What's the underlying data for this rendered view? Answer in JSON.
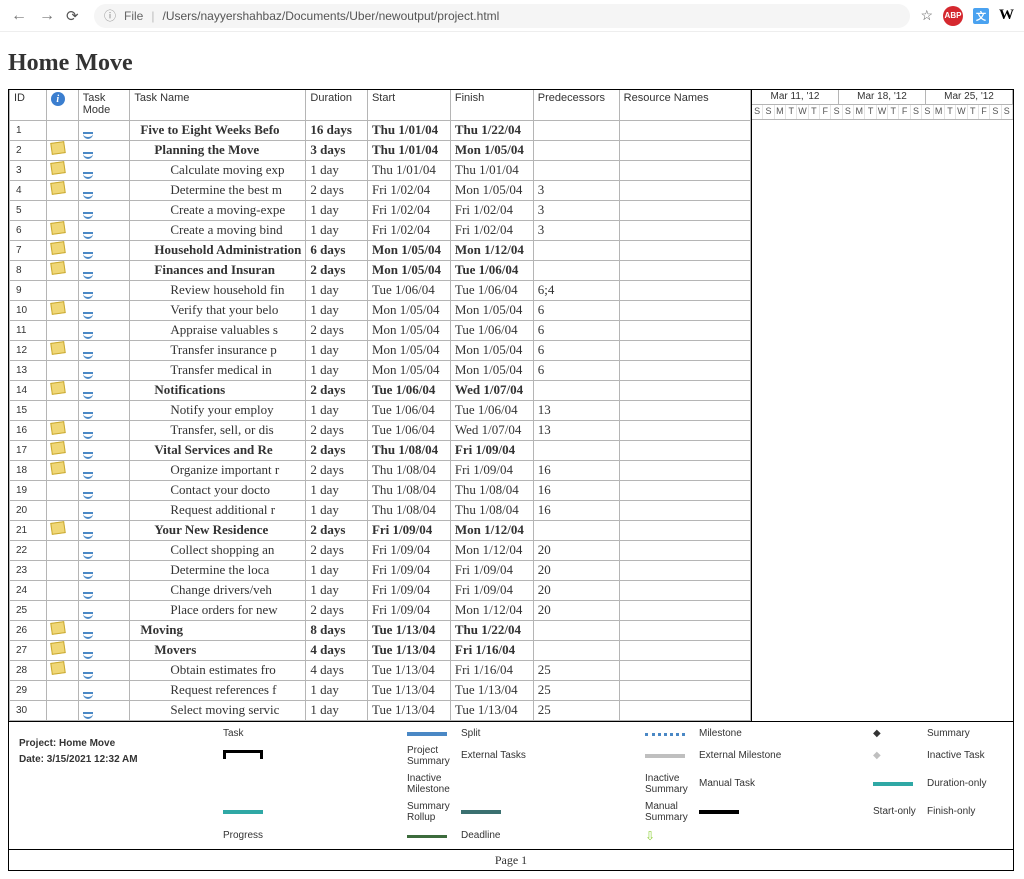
{
  "browser": {
    "omnibox_prefix": "File",
    "url": "/Users/nayyershahbaz/Documents/Uber/newoutput/project.html",
    "ext_abp": "ABP",
    "ext_w": "W"
  },
  "title": "Home Move",
  "headers": {
    "id": "ID",
    "info": "",
    "task_mode": "Task Mode",
    "task_name": "Task Name",
    "duration": "Duration",
    "start": "Start",
    "finish": "Finish",
    "predecessors": "Predecessors",
    "resource_names": "Resource Names"
  },
  "timeline_months": [
    "Mar 11, '12",
    "Mar 18, '12",
    "Mar 25, '12"
  ],
  "timeline_days": [
    "S",
    "S",
    "M",
    "T",
    "W",
    "T",
    "F",
    "S",
    "S",
    "M",
    "T",
    "W",
    "T",
    "F",
    "S",
    "S",
    "M",
    "T",
    "W",
    "T",
    "F",
    "S",
    "S"
  ],
  "rows": [
    {
      "id": "1",
      "note": false,
      "bold": true,
      "indent": 1,
      "name": "Five to Eight Weeks Befo",
      "dur": "16 days",
      "start": "Thu 1/01/04",
      "finish": "Thu 1/22/04",
      "pred": ""
    },
    {
      "id": "2",
      "note": true,
      "bold": true,
      "indent": 2,
      "name": "Planning the Move",
      "dur": "3 days",
      "start": "Thu 1/01/04",
      "finish": "Mon 1/05/04",
      "pred": ""
    },
    {
      "id": "3",
      "note": true,
      "bold": false,
      "indent": 3,
      "name": "Calculate moving exp",
      "dur": "1 day",
      "start": "Thu 1/01/04",
      "finish": "Thu 1/01/04",
      "pred": ""
    },
    {
      "id": "4",
      "note": true,
      "bold": false,
      "indent": 3,
      "name": "Determine the best m",
      "dur": "2 days",
      "start": "Fri 1/02/04",
      "finish": "Mon 1/05/04",
      "pred": "3"
    },
    {
      "id": "5",
      "note": false,
      "bold": false,
      "indent": 3,
      "name": "Create a moving-expe",
      "dur": "1 day",
      "start": "Fri 1/02/04",
      "finish": "Fri 1/02/04",
      "pred": "3"
    },
    {
      "id": "6",
      "note": true,
      "bold": false,
      "indent": 3,
      "name": "Create a moving bind",
      "dur": "1 day",
      "start": "Fri 1/02/04",
      "finish": "Fri 1/02/04",
      "pred": "3"
    },
    {
      "id": "7",
      "note": true,
      "bold": true,
      "indent": 2,
      "name": "Household Administration",
      "dur": "6 days",
      "start": "Mon 1/05/04",
      "finish": "Mon 1/12/04",
      "pred": ""
    },
    {
      "id": "8",
      "note": true,
      "bold": true,
      "indent": 2,
      "name": "Finances and Insuran",
      "dur": "2 days",
      "start": "Mon 1/05/04",
      "finish": "Tue 1/06/04",
      "pred": ""
    },
    {
      "id": "9",
      "note": false,
      "bold": false,
      "indent": 3,
      "name": "Review household fin",
      "dur": "1 day",
      "start": "Tue 1/06/04",
      "finish": "Tue 1/06/04",
      "pred": "6;4"
    },
    {
      "id": "10",
      "note": true,
      "bold": false,
      "indent": 3,
      "name": "Verify that your belo",
      "dur": "1 day",
      "start": "Mon 1/05/04",
      "finish": "Mon 1/05/04",
      "pred": "6"
    },
    {
      "id": "11",
      "note": false,
      "bold": false,
      "indent": 3,
      "name": "Appraise valuables s",
      "dur": "2 days",
      "start": "Mon 1/05/04",
      "finish": "Tue 1/06/04",
      "pred": "6"
    },
    {
      "id": "12",
      "note": true,
      "bold": false,
      "indent": 3,
      "name": "Transfer insurance p",
      "dur": "1 day",
      "start": "Mon 1/05/04",
      "finish": "Mon 1/05/04",
      "pred": "6"
    },
    {
      "id": "13",
      "note": false,
      "bold": false,
      "indent": 3,
      "name": "Transfer medical in",
      "dur": "1 day",
      "start": "Mon 1/05/04",
      "finish": "Mon 1/05/04",
      "pred": "6"
    },
    {
      "id": "14",
      "note": true,
      "bold": true,
      "indent": 2,
      "name": "Notifications",
      "dur": "2 days",
      "start": "Tue 1/06/04",
      "finish": "Wed 1/07/04",
      "pred": ""
    },
    {
      "id": "15",
      "note": false,
      "bold": false,
      "indent": 3,
      "name": "Notify your employ",
      "dur": "1 day",
      "start": "Tue 1/06/04",
      "finish": "Tue 1/06/04",
      "pred": "13"
    },
    {
      "id": "16",
      "note": true,
      "bold": false,
      "indent": 3,
      "name": "Transfer, sell, or dis",
      "dur": "2 days",
      "start": "Tue 1/06/04",
      "finish": "Wed 1/07/04",
      "pred": "13"
    },
    {
      "id": "17",
      "note": true,
      "bold": true,
      "indent": 2,
      "name": "Vital Services and Re",
      "dur": "2 days",
      "start": "Thu 1/08/04",
      "finish": "Fri 1/09/04",
      "pred": ""
    },
    {
      "id": "18",
      "note": true,
      "bold": false,
      "indent": 3,
      "name": "Organize important r",
      "dur": "2 days",
      "start": "Thu 1/08/04",
      "finish": "Fri 1/09/04",
      "pred": "16"
    },
    {
      "id": "19",
      "note": false,
      "bold": false,
      "indent": 3,
      "name": "Contact your docto",
      "dur": "1 day",
      "start": "Thu 1/08/04",
      "finish": "Thu 1/08/04",
      "pred": "16"
    },
    {
      "id": "20",
      "note": false,
      "bold": false,
      "indent": 3,
      "name": "Request additional r",
      "dur": "1 day",
      "start": "Thu 1/08/04",
      "finish": "Thu 1/08/04",
      "pred": "16"
    },
    {
      "id": "21",
      "note": true,
      "bold": true,
      "indent": 2,
      "name": "Your New Residence",
      "dur": "2 days",
      "start": "Fri 1/09/04",
      "finish": "Mon 1/12/04",
      "pred": ""
    },
    {
      "id": "22",
      "note": false,
      "bold": false,
      "indent": 3,
      "name": "Collect shopping an",
      "dur": "2 days",
      "start": "Fri 1/09/04",
      "finish": "Mon 1/12/04",
      "pred": "20"
    },
    {
      "id": "23",
      "note": false,
      "bold": false,
      "indent": 3,
      "name": "Determine the loca",
      "dur": "1 day",
      "start": "Fri 1/09/04",
      "finish": "Fri 1/09/04",
      "pred": "20"
    },
    {
      "id": "24",
      "note": false,
      "bold": false,
      "indent": 3,
      "name": "Change drivers/veh",
      "dur": "1 day",
      "start": "Fri 1/09/04",
      "finish": "Fri 1/09/04",
      "pred": "20"
    },
    {
      "id": "25",
      "note": false,
      "bold": false,
      "indent": 3,
      "name": "Place orders for new",
      "dur": "2 days",
      "start": "Fri 1/09/04",
      "finish": "Mon 1/12/04",
      "pred": "20"
    },
    {
      "id": "26",
      "note": true,
      "bold": true,
      "indent": 1,
      "name": "Moving",
      "dur": "8 days",
      "start": "Tue 1/13/04",
      "finish": "Thu 1/22/04",
      "pred": ""
    },
    {
      "id": "27",
      "note": true,
      "bold": true,
      "indent": 2,
      "name": "Movers",
      "dur": "4 days",
      "start": "Tue 1/13/04",
      "finish": "Fri 1/16/04",
      "pred": ""
    },
    {
      "id": "28",
      "note": true,
      "bold": false,
      "indent": 3,
      "name": "Obtain estimates fro",
      "dur": "4 days",
      "start": "Tue 1/13/04",
      "finish": "Fri 1/16/04",
      "pred": "25"
    },
    {
      "id": "29",
      "note": false,
      "bold": false,
      "indent": 3,
      "name": "Request references f",
      "dur": "1 day",
      "start": "Tue 1/13/04",
      "finish": "Tue 1/13/04",
      "pred": "25"
    },
    {
      "id": "30",
      "note": false,
      "bold": false,
      "indent": 3,
      "name": "Select moving servic",
      "dur": "1 day",
      "start": "Tue 1/13/04",
      "finish": "Tue 1/13/04",
      "pred": "25"
    }
  ],
  "legend": {
    "project_label": "Project: Home Move",
    "date_label": "Date: 3/15/2021 12:32 AM",
    "task": "Task",
    "split": "Split",
    "milestone": "Milestone",
    "summary": "Summary",
    "project_summary": "Project Summary",
    "ext_tasks": "External Tasks",
    "ext_mile": "External Milestone",
    "inactive_task": "Inactive Task",
    "inactive_mile": "Inactive Milestone",
    "inactive_summary": "Inactive Summary",
    "manual_task": "Manual Task",
    "dur_only": "Duration-only",
    "sum_rollup": "Summary Rollup",
    "man_summary": "Manual Summary",
    "start_only": "Start-only",
    "finish_only": "Finish-only",
    "progress": "Progress",
    "deadline": "Deadline"
  },
  "footer": "Page 1"
}
